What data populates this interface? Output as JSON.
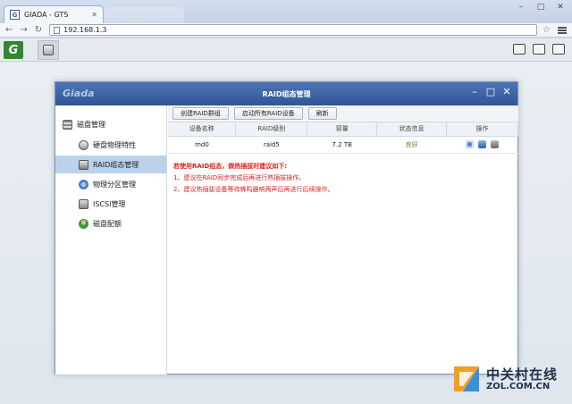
{
  "browser": {
    "tab_favicon": "G",
    "tab_title": "GIADA - GTS",
    "address": "192.168.1.3"
  },
  "app": {
    "logo_letter": "G"
  },
  "window": {
    "brand": "Giada",
    "title": "RAID组态管理"
  },
  "sidebar": {
    "group_label": "磁盘管理",
    "items": [
      {
        "label": "硬盘物理特性",
        "icon": "hdd-icon"
      },
      {
        "label": "RAID组态管理",
        "icon": "raid-icon"
      },
      {
        "label": "物理分区管理",
        "icon": "partition-icon"
      },
      {
        "label": "ISCSI管理",
        "icon": "iscsi-icon"
      },
      {
        "label": "磁盘配额",
        "icon": "quota-icon"
      }
    ]
  },
  "toolbar": {
    "create_label": "创建RAID群组",
    "start_label": "启动所有RAID设备",
    "refresh_label": "刷新"
  },
  "table": {
    "headers": [
      "设备名称",
      "RAID级别",
      "容量",
      "状态信息",
      "操作"
    ],
    "rows": [
      {
        "name": "md0",
        "level": "raid5",
        "capacity": "7.2 TB",
        "status": "良好"
      }
    ]
  },
  "notes": {
    "heading": "若使用RAID组态，做热插拔时建议如下:",
    "items": [
      "1、建议在RAID同步完成后再进行热插拔操作。",
      "2、建议热插拔设备等待蜂鸣器响两声后再进行后续操作。"
    ]
  },
  "watermark": {
    "cn": "中关村在线",
    "en": "ZOL.COM.CN"
  },
  "colors": {
    "title_bar": "#2f5596",
    "active_item": "#bcd1ec",
    "note_red": "#d22222"
  }
}
